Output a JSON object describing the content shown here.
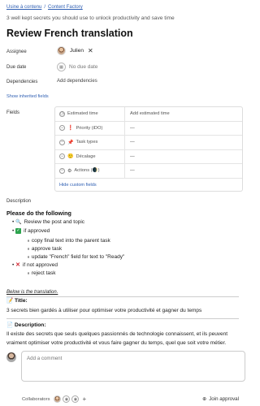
{
  "breadcrumb": {
    "a": "Usine à contenu",
    "sep": "/",
    "b": "Content Factory"
  },
  "task": {
    "subtitle": "3 well kept secrets you should use to unlock productivity and save time",
    "title": "Review French translation"
  },
  "labels": {
    "assignee": "Assignee",
    "due_date": "Due date",
    "dependencies": "Dependencies",
    "show_inherited": "Show inherited fields",
    "fields": "Fields",
    "description": "Description"
  },
  "assignee": {
    "name": "Julien",
    "remove": "✕"
  },
  "due": {
    "placeholder": "No due date"
  },
  "dependencies": {
    "add": "Add dependencies"
  },
  "fields": {
    "header": {
      "c1": "Estimated time",
      "c2": "Add estimated time"
    },
    "rows": [
      {
        "label": "Priority (iDO)",
        "emoji": "❗",
        "value": "—"
      },
      {
        "label": "Task types",
        "emoji": "📌",
        "value": "—"
      },
      {
        "label": "Décalage",
        "emoji": "🙂",
        "value": "—"
      },
      {
        "label": "Actions (🌒)",
        "emoji": "⚙",
        "value": "—"
      }
    ],
    "hide": "Hide custom fields"
  },
  "description": {
    "heading": "Please do the following",
    "l1": "Review the post and topic",
    "l2": "if approved",
    "l2a": "copy final text into the parent task",
    "l2b": "approve task",
    "l2c": "update \"French\" field for text to \"Ready\"",
    "l3": "if not approved",
    "l3a": "reject task",
    "below": "Below is the translation.",
    "t_label": "Title:",
    "t_text": "3 secrets bien gardés à utiliser pour optimiser votre productivité et gagner du temps",
    "d_label": "Description:",
    "d_text": "Il existe des secrets que seuls quelques passionnés de technologie connaissent, et ils peuvent vraiment optimiser votre productivité et vous faire gagner du temps, quel que soit votre métier."
  },
  "comment": {
    "placeholder": "Add a comment"
  },
  "footer": {
    "collaborators": "Collaborators",
    "join": "Join approval"
  }
}
